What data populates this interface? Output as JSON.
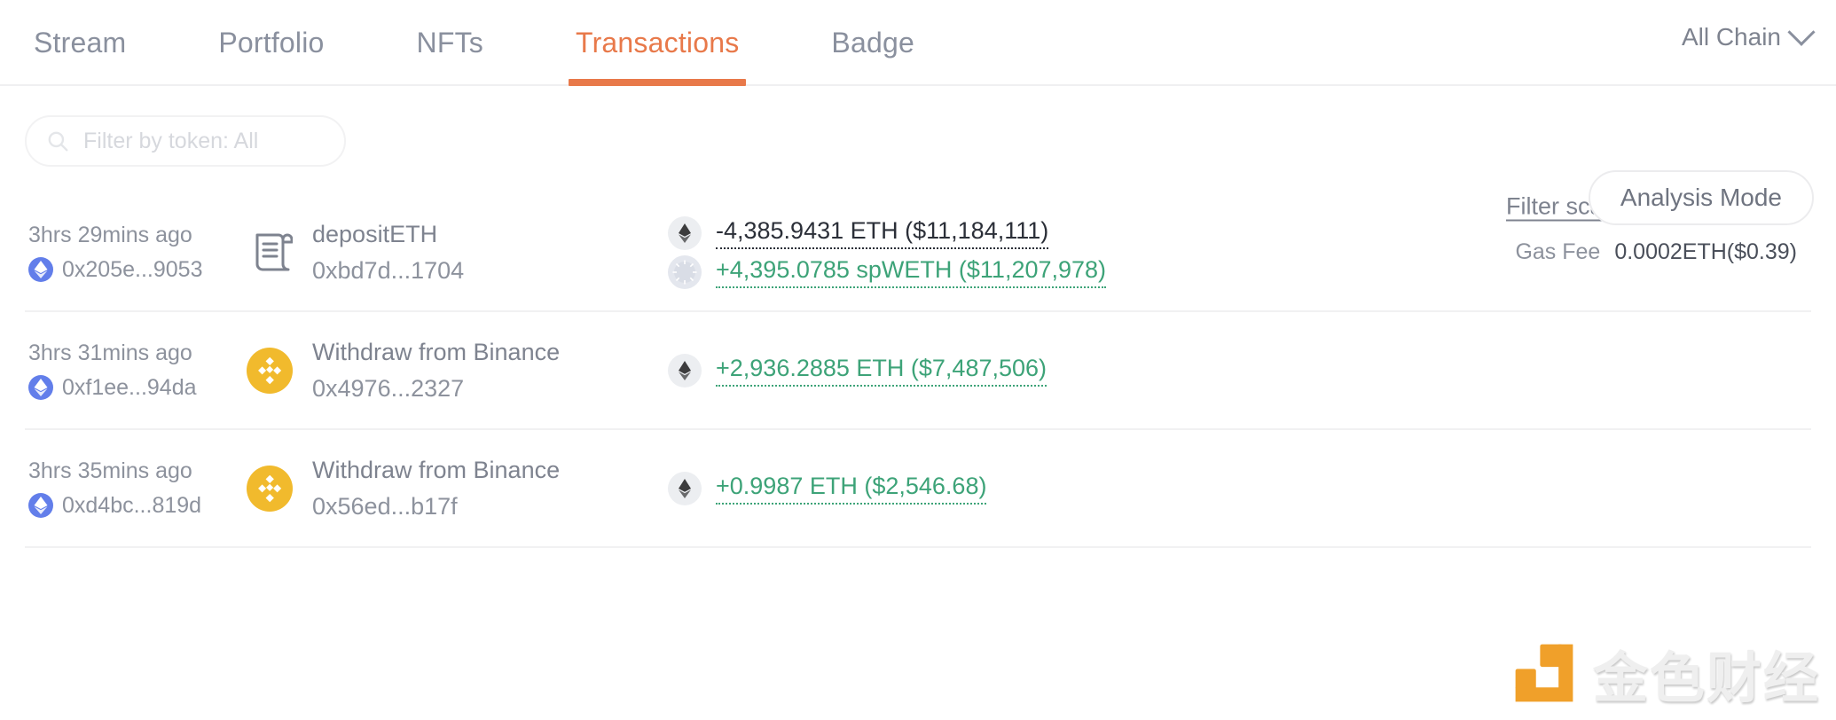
{
  "nav": {
    "tabs": [
      {
        "label": "Stream",
        "active": false
      },
      {
        "label": "Portfolio",
        "active": false
      },
      {
        "label": "NFTs",
        "active": false
      },
      {
        "label": "Transactions",
        "active": true
      },
      {
        "label": "Badge",
        "active": false
      }
    ],
    "chain_selector": {
      "label": "All Chain",
      "icon": "chevron-down-icon"
    },
    "active_color": "#e8794a",
    "inactive_color": "#8a909e"
  },
  "toolbar": {
    "search": {
      "placeholder": "Filter by token: All",
      "value": "",
      "icon": "search-icon"
    },
    "filter_scam_label": "Filter scam",
    "analysis_mode_label": "Analysis Mode"
  },
  "transactions": [
    {
      "time_ago": "3hrs 29mins ago",
      "chain_icon": "ethereum-icon",
      "tx_hash": "0x205e...9053",
      "action_icon": "contract-document-icon",
      "action_name": "depositETH",
      "action_hash": "0xbd7d...1704",
      "amounts": [
        {
          "token_icon": "ethereum-token-icon",
          "text": "-4,385.9431 ETH ($11,184,111)",
          "direction": "negative"
        },
        {
          "token_icon": "spweth-token-icon",
          "text": "+4,395.0785 spWETH ($11,207,978)",
          "direction": "positive"
        }
      ],
      "gas_label": "Gas Fee",
      "gas_value": "0.0002ETH($0.39)"
    },
    {
      "time_ago": "3hrs 31mins ago",
      "chain_icon": "ethereum-icon",
      "tx_hash": "0xf1ee...94da",
      "action_icon": "binance-icon",
      "action_name": "Withdraw from Binance",
      "action_hash": "0x4976...2327",
      "amounts": [
        {
          "token_icon": "ethereum-token-icon",
          "text": "+2,936.2885 ETH ($7,487,506)",
          "direction": "positive"
        }
      ],
      "gas_label": "",
      "gas_value": ""
    },
    {
      "time_ago": "3hrs 35mins ago",
      "chain_icon": "ethereum-icon",
      "tx_hash": "0xd4bc...819d",
      "action_icon": "binance-icon",
      "action_name": "Withdraw from Binance",
      "action_hash": "0x56ed...b17f",
      "amounts": [
        {
          "token_icon": "ethereum-token-icon",
          "text": "+0.9987 ETH ($2,546.68)",
          "direction": "positive"
        }
      ],
      "gas_label": "",
      "gas_value": ""
    }
  ],
  "watermark": {
    "text": "金色财经",
    "mark_color": "#f0a02a"
  },
  "colors": {
    "accent_orange": "#e8794a",
    "positive_green": "#3da378",
    "negative_dark": "#2b2f38",
    "muted_gray": "#8d929d",
    "binance_gold": "#f1ba2d",
    "ethereum_purple": "#627eea"
  }
}
